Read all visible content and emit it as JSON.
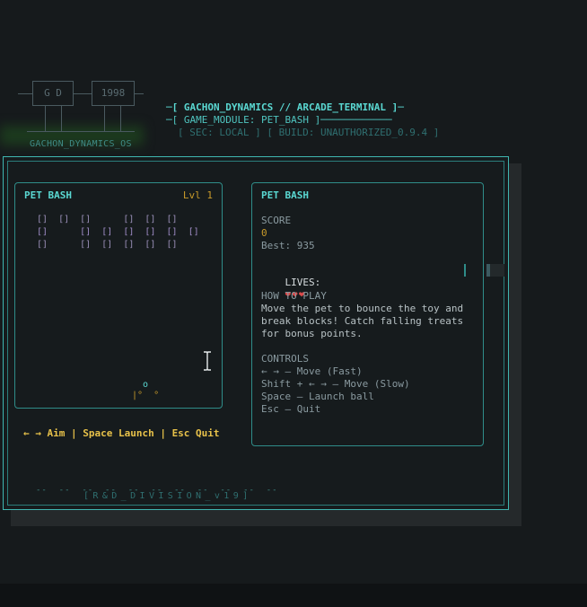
{
  "logo": {
    "box_left": "G  D",
    "box_right": "1998",
    "caption": "GACHON_DYNAMICS_OS"
  },
  "header": {
    "line1": "─[ GACHON_DYNAMICS // ARCADE_TERMINAL ]─",
    "line2": "─[ GAME_MODULE: PET_BASH ]────────────",
    "line3": "[ SEC: LOCAL ] [ BUILD: UNAUTHORIZED_0.9.4 ]"
  },
  "game": {
    "title": "PET BASH",
    "level": "Lvl 1",
    "ball_glyph": "o",
    "paddle_glyph": "|°  °",
    "blocks_row1": "[]  []  []      []  []  []",
    "blocks_row2": "[]      []  []  []  []  []  []",
    "blocks_row3": "[]      []  []  []  []  []"
  },
  "hint": "← → Aim  |  Space Launch  |  Esc Quit",
  "info": {
    "title": "PET BASH",
    "score_label": "SCORE",
    "score_value": "0",
    "best": "Best: 935",
    "lives_label": "LIVES:",
    "lives_hearts": "❤❤❤",
    "howto_label": "HOW TO PLAY",
    "howto_text": "Move the pet to bounce the toy and break blocks! Catch falling treats for bonus points.",
    "controls_label": "CONTROLS",
    "controls": [
      "← → — Move (Fast)",
      "Shift + ← → — Move (Slow)",
      "Space — Launch ball",
      "Esc — Quit"
    ]
  },
  "footer": "[R&D_DIVISION_v19]",
  "colors": {
    "accent": "#5ad8d2",
    "border": "#2f8d89",
    "orange": "#c89a2a",
    "yellow": "#e8c24a",
    "heart": "#d94a4a",
    "background": "#161a1c"
  },
  "icons": {
    "cursor": "text-cursor-icon"
  }
}
